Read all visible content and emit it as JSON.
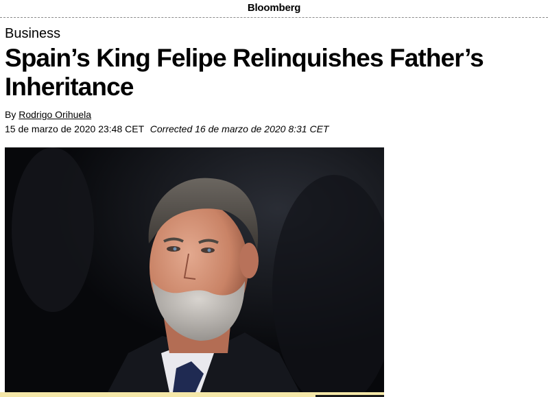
{
  "header": {
    "brand": "Bloomberg"
  },
  "article": {
    "section": "Business",
    "headline": "Spain’s King Felipe Relinquishes Father’s Inheritance",
    "byline_prefix": "By",
    "author": "Rodrigo Orihuela",
    "published": "15 de marzo de 2020 23:48 CET",
    "corrected": "Corrected 16 de marzo de 2020 8:31 CET"
  },
  "colors": {
    "text": "#000000",
    "background": "#ffffff",
    "photo_background": "#0d0f14",
    "bottom_strip": "#f4e7a8"
  }
}
